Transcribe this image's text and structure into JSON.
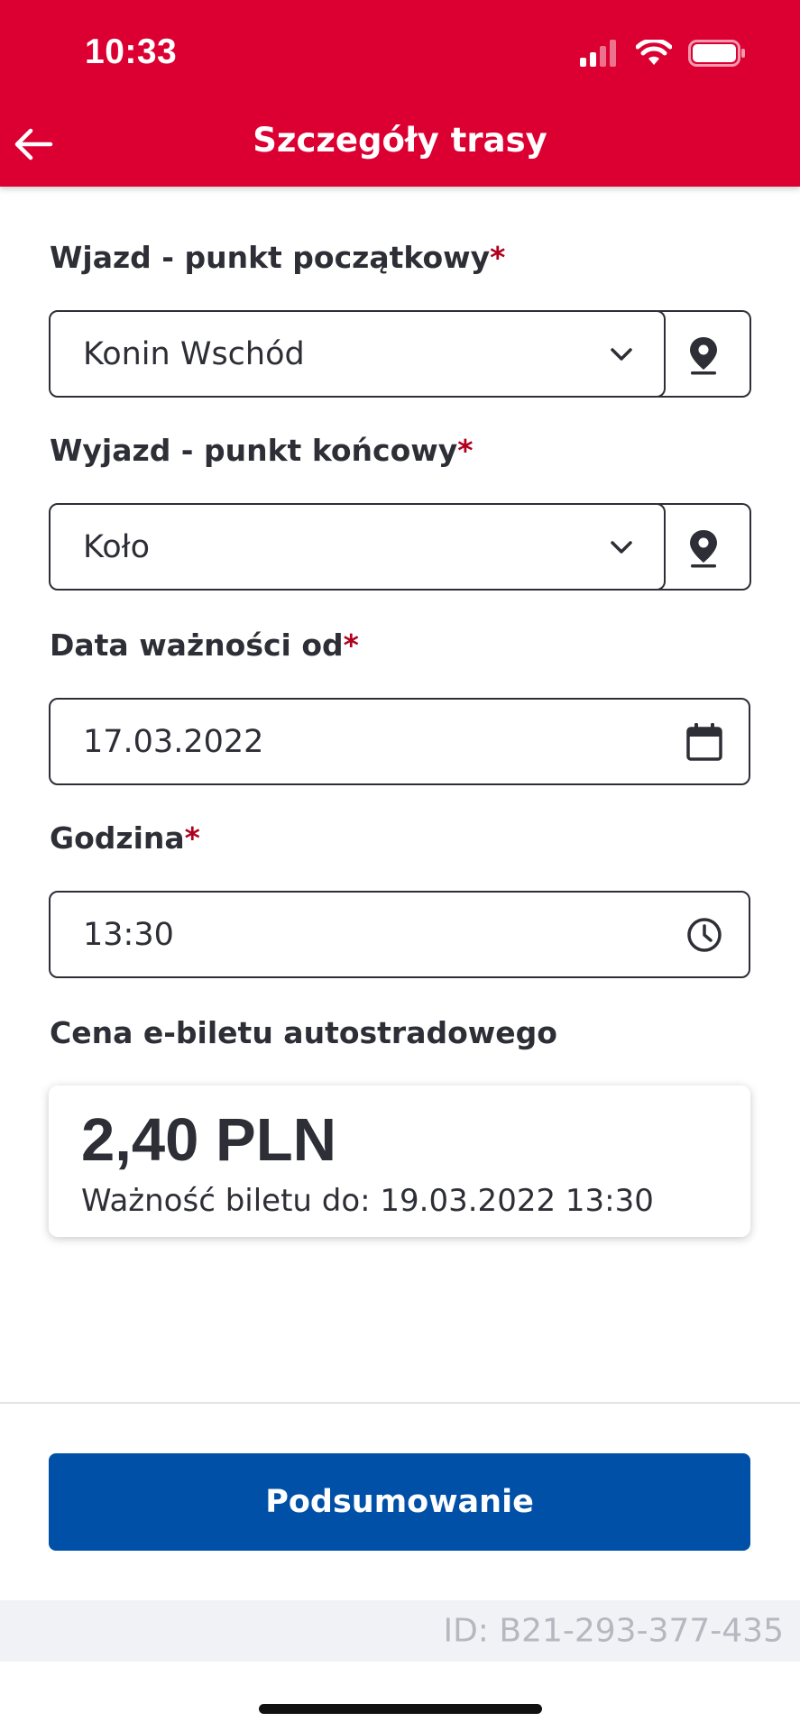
{
  "status_bar": {
    "time": "10:33"
  },
  "header": {
    "title": "Szczegóły trasy"
  },
  "form": {
    "entry": {
      "label": "Wjazd - punkt początkowy",
      "required_mark": "*",
      "value": "Konin Wschód"
    },
    "exit": {
      "label": "Wyjazd - punkt końcowy",
      "required_mark": "*",
      "value": "Koło"
    },
    "date": {
      "label": "Data ważności od",
      "required_mark": "*",
      "value": "17.03.2022"
    },
    "time": {
      "label": "Godzina",
      "required_mark": "*",
      "value": "13:30"
    }
  },
  "price": {
    "label": "Cena e-biletu autostradowego",
    "amount": "2,40 PLN",
    "validity": "Ważność biletu do: 19.03.2022 13:30"
  },
  "actions": {
    "summary_button": "Podsumowanie"
  },
  "footer": {
    "id_text": "ID: B21-293-377-435"
  },
  "colors": {
    "brand_red": "#dc0032",
    "primary_blue": "#0050a7",
    "required_red": "#b0001e"
  }
}
